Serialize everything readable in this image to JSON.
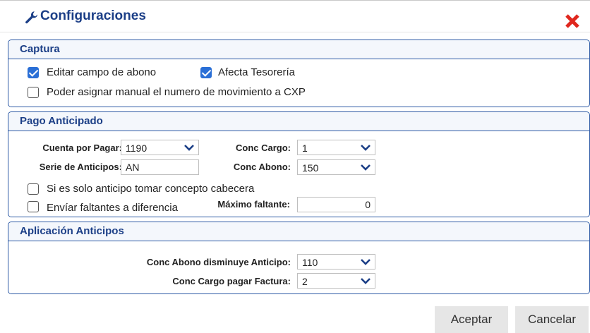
{
  "dialog": {
    "title": "Configuraciones",
    "icons": {
      "title": "wrench-icon",
      "close": "close-icon"
    },
    "colors": {
      "title": "#1c3f87",
      "border": "#2d5aa5",
      "checkbox": "#2a6fd6",
      "close": "#e0271e"
    }
  },
  "captura": {
    "title": "Captura",
    "editar_campo": {
      "label": "Editar campo de abono",
      "checked": true
    },
    "afecta_tesoreria": {
      "label": "Afecta Tesorería",
      "checked": true
    },
    "poder_asignar": {
      "label": "Poder asignar manual el numero de movimiento a CXP",
      "checked": false
    }
  },
  "pago": {
    "title": "Pago Anticipado",
    "cuenta_por_pagar": {
      "label": "Cuenta por Pagar:",
      "value": "1190"
    },
    "serie_anticipos": {
      "label": "Serie de Anticipos:",
      "value": "AN"
    },
    "conc_cargo": {
      "label": "Conc Cargo:",
      "value": "1"
    },
    "conc_abono": {
      "label": "Conc Abono:",
      "value": "150"
    },
    "solo_anticipo": {
      "label": "Si es solo anticipo tomar concepto cabecera",
      "checked": false
    },
    "enviar_faltantes": {
      "label": "Envíar faltantes a diferencia",
      "checked": false
    },
    "maximo_faltante": {
      "label": "Máximo faltante:",
      "value": "0"
    }
  },
  "aplicacion": {
    "title": "Aplicación Anticipos",
    "conc_abono_disminuye": {
      "label": "Conc Abono disminuye Anticipo:",
      "value": "110"
    },
    "conc_cargo_pagar": {
      "label": "Conc Cargo pagar Factura:",
      "value": "2"
    }
  },
  "buttons": {
    "accept": "Aceptar",
    "cancel": "Cancelar"
  }
}
